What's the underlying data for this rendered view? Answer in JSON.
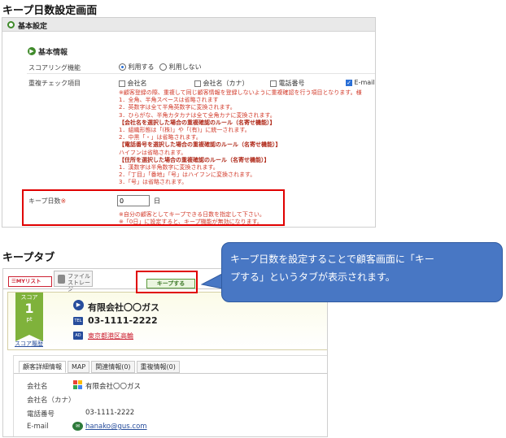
{
  "section1_title": "キープ日数設定画面",
  "settings": {
    "header": "基本設定",
    "subheader": "基本情報",
    "score_label": "スコアリング機能",
    "score_options": [
      "利用する",
      "利用しない"
    ],
    "dup_label": "重複チェック項目",
    "dup_options": [
      "会社名",
      "会社名（カナ）",
      "電話番号",
      "E-mail"
    ],
    "dup_notes": [
      "※顧客登録の際、重複して同じ顧客情報を登録しないように重複確認を行う項目となります。様",
      "1．全角、半角スペースは省略されます",
      "2．英数字は全て半角英数字に変換されます。",
      "3．ひらがな、半角カタカナは全て全角カナに変換されます。",
      "【会社名を選択した場合の重複確認のルール（名寄せ機能）】",
      "1．組織形態は「(株)」や「(有)」に統一されます。",
      "2．中黒「・」は省略されます。",
      "【電話番号を選択した場合の重複確認のルール（名寄せ機能）】",
      "ハイフンは省略されます。",
      "【住所を選択した場合の重複確認のルール（名寄せ機能）】",
      "1．漢数字は半角数字に変換されます。",
      "2．「丁目」「番地」「号」はハイフンに変換されます。",
      "3．「号」は省略されます。"
    ],
    "keep_label": "キープ日数",
    "keep_required": "※",
    "keep_value": "0",
    "keep_unit": "日",
    "keep_notes": [
      "※自分の顧客としてキープできる日数を指定して下さい。",
      "※「0日」に設定すると、キープ機能が無効になります。"
    ]
  },
  "section2_title": "キープタブ",
  "tabs": {
    "my_list": "MYリスト",
    "file_storage_line1": "ファイル",
    "file_storage_line2": "ストレージ",
    "keep": "キープする"
  },
  "card": {
    "score_label": "スコア",
    "score_value": "1",
    "score_unit": "pt",
    "score_history": "スコア履歴",
    "company": "有限会社〇〇ガス",
    "phone_badge": "TEL",
    "phone": "03-1111-2222",
    "addr_badge": "AD",
    "address": "東京都港区高輪"
  },
  "detail": {
    "tabs": [
      "顧客詳細情報",
      "MAP",
      "関連情報(0)",
      "重複情報(0)"
    ],
    "rows": [
      {
        "label": "会社名",
        "value": "有限会社〇〇ガス"
      },
      {
        "label": "会社名（カナ）",
        "value": ""
      },
      {
        "label": "電話番号",
        "value": "03-1111-2222"
      },
      {
        "label": "E-mail",
        "value": "hanako@gus.com"
      }
    ]
  },
  "callout": {
    "line1": "キープ日数を設定することで顧客画面に「キー",
    "line2": "プする」というタブが表示されます。"
  },
  "colors": {
    "highlight": "#e00000",
    "callout": "#4877c4",
    "green": "#3f8a2a",
    "score_flag": "#7fb23b",
    "note_red": "#d23a2a"
  }
}
